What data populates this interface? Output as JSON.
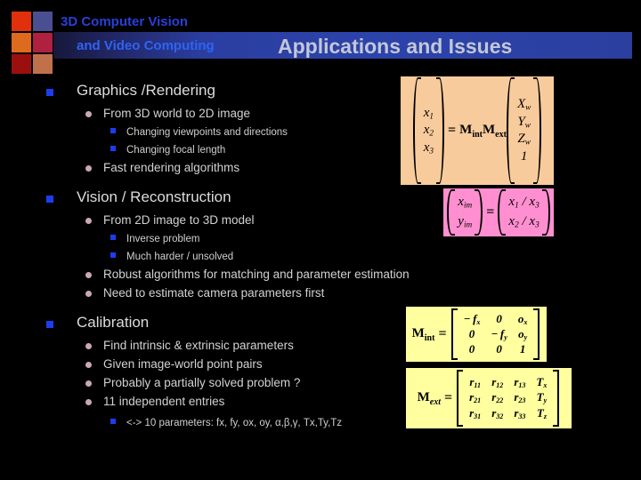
{
  "header": {
    "course_line1": "3D Computer Vision",
    "course_line2": "and Video Computing",
    "slide_title": "Applications and Issues",
    "logo_colors": [
      "#e0300c",
      "#4a4f92",
      "#de6a1e",
      "#b02040",
      "#9c0f0f",
      "#c0714c"
    ],
    "band_color": "#2c43ab",
    "line1_color": "#2a3fd8",
    "line2_color": "#2f63f5",
    "title_color": "#c3c7d8"
  },
  "outline": {
    "sections": [
      {
        "title": "Graphics /Rendering",
        "items": [
          {
            "text": "From 3D world to 2D image",
            "sub": [
              "Changing viewpoints and directions",
              "Changing focal length"
            ]
          },
          {
            "text": "Fast rendering algorithms",
            "sub": []
          }
        ]
      },
      {
        "title": "Vision / Reconstruction",
        "items": [
          {
            "text": "From 2D image to 3D model",
            "sub": [
              "Inverse problem",
              "Much harder / unsolved"
            ]
          },
          {
            "text": "Robust algorithms for matching and parameter estimation",
            "sub": []
          },
          {
            "text": "Need to estimate camera parameters first",
            "sub": []
          }
        ]
      },
      {
        "title": "Calibration",
        "items": [
          {
            "text": "Find intrinsic & extrinsic parameters",
            "sub": []
          },
          {
            "text": "Given image-world point pairs",
            "sub": []
          },
          {
            "text": "Probably a partially solved problem ?",
            "sub": []
          },
          {
            "text": "11 independent entries",
            "sub": [
              "<-> 10 parameters: fx, fy, ox, oy, α,β,γ, Tx,Ty,Tz"
            ]
          }
        ]
      }
    ],
    "bullet_colors": {
      "level1": "#1b3df0",
      "level2": "#c9a7b8",
      "level3": "#1b3df0"
    }
  },
  "equations": {
    "projection": {
      "name": "projection-equation",
      "background": "#f8cb9c",
      "lhs": [
        "x1",
        "x2",
        "x3"
      ],
      "operator": "=",
      "matrices": "MintMext",
      "rhs": [
        "Xw",
        "Yw",
        "Zw",
        "1"
      ]
    },
    "image_coords": {
      "name": "image-coordinate-equation",
      "background": "#ff8fd0",
      "lhs": [
        "xim",
        "yim"
      ],
      "operator": "=",
      "rhs": [
        "x1 / x3",
        "x2 / x3"
      ]
    },
    "m_int": {
      "name": "intrinsic-matrix",
      "background": "#ffffa0",
      "label": "Mint",
      "operator": "=",
      "rows": [
        [
          "− fx",
          "0",
          "ox"
        ],
        [
          "0",
          "− fy",
          "oy"
        ],
        [
          "0",
          "0",
          "1"
        ]
      ]
    },
    "m_ext": {
      "name": "extrinsic-matrix",
      "background": "#ffffa0",
      "label": "Mext",
      "operator": "=",
      "rows": [
        [
          "r11",
          "r12",
          "r13",
          "Tx"
        ],
        [
          "r21",
          "r22",
          "r23",
          "Ty"
        ],
        [
          "r31",
          "r32",
          "r33",
          "Tz"
        ]
      ]
    }
  }
}
